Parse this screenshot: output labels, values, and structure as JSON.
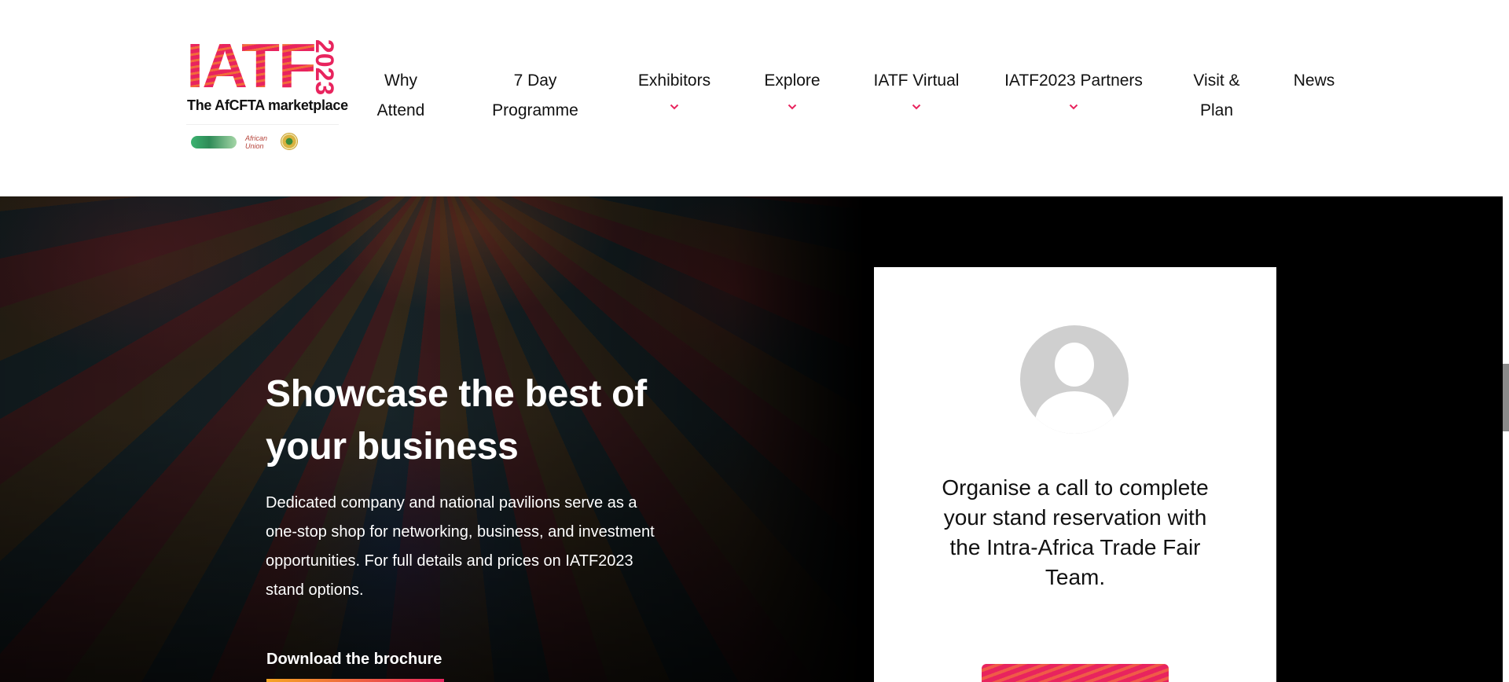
{
  "brand": {
    "logo_word": "IATF",
    "logo_year": "2023",
    "tagline": "The AfCFTA marketplace",
    "partner_text": "African Union",
    "accent_color": "#e8245e"
  },
  "nav": {
    "items": [
      {
        "line1": "Why",
        "line2": "Attend",
        "has_dropdown": false
      },
      {
        "line1": "7 Day",
        "line2": "Programme",
        "has_dropdown": false
      },
      {
        "line1": "Exhibitors",
        "line2": "",
        "has_dropdown": true
      },
      {
        "line1": "Explore",
        "line2": "",
        "has_dropdown": true
      },
      {
        "line1": "IATF Virtual",
        "line2": "",
        "has_dropdown": true
      },
      {
        "line1": "IATF2023 Partners",
        "line2": "",
        "has_dropdown": true
      },
      {
        "line1": "Visit &",
        "line2": "Plan",
        "has_dropdown": false
      },
      {
        "line1": "News",
        "line2": "",
        "has_dropdown": false
      }
    ]
  },
  "hero": {
    "title_line1": "Showcase the best of",
    "title_line2": "your business",
    "description": "Dedicated company and national pavilions serve as a one-stop shop for networking, business, and investment opportunities. For full details and prices on IATF2023 stand options.",
    "cta_label": "Download the brochure"
  },
  "card": {
    "text": "Organise a call to complete your stand reservation with the Intra-Africa Trade Fair Team."
  }
}
